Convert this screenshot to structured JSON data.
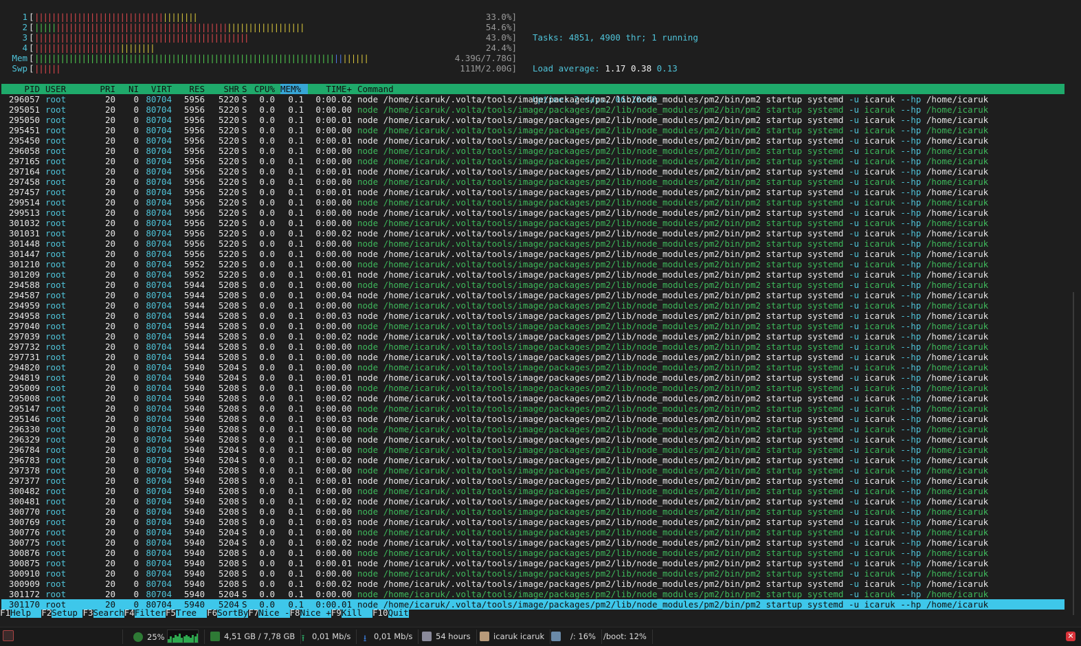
{
  "meters": [
    {
      "label": "1",
      "value": "33.0%]",
      "bars": [
        [
          "red",
          30
        ],
        [
          "yellow",
          8
        ]
      ]
    },
    {
      "label": "2",
      "value": "54.6%]",
      "bars": [
        [
          "green",
          5
        ],
        [
          "red",
          40
        ],
        [
          "yellow",
          18
        ]
      ]
    },
    {
      "label": "3",
      "value": "43.0%]",
      "bars": [
        [
          "red",
          50
        ]
      ]
    },
    {
      "label": "4",
      "value": "24.4%]",
      "bars": [
        [
          "red",
          20
        ],
        [
          "yellow",
          8
        ]
      ]
    },
    {
      "label": "Mem",
      "value": "4.39G/7.78G]",
      "bars": [
        [
          "green",
          70
        ],
        [
          "blue",
          2
        ],
        [
          "yellow",
          6
        ]
      ]
    },
    {
      "label": "Swp",
      "value": "111M/2.00G]",
      "bars": [
        [
          "red",
          6
        ]
      ]
    }
  ],
  "info": {
    "tasks_label": "Tasks: ",
    "tasks_value": "4851, ",
    "thr_value": "4900",
    "thr_label": " thr; ",
    "running_value": "1",
    "running_label": " running",
    "load_label": "Load average: ",
    "load_1": "1.17",
    "load_5": "0.38",
    "load_15": "0.13",
    "uptime_label": "Uptime: ",
    "uptime_value": "2 days, 06:10:08"
  },
  "header": {
    "pid": "PID",
    "user": "USER",
    "pri": "PRI",
    "ni": "NI",
    "virt": "VIRT",
    "res": "RES",
    "shr": "SHR",
    "s": "S",
    "cpu": "CPU%",
    "mem": "MEM%",
    "time": "TIME+",
    "command": "Command"
  },
  "common": {
    "user": "root",
    "pri": "20",
    "ni": "0",
    "virt": "80704",
    "s": "S",
    "cpu": "0.0",
    "mem": "0.1",
    "cmd_prefix": "node /home/icaruk/.volta/tools/image/packages/pm2/lib/node_modules/pm2/bin/pm2 startup systemd ",
    "flag_u": "-u",
    "cmd_user": " icaruk ",
    "flag_hp": "--hp",
    "cmd_home": " /home/icaruk"
  },
  "processes": [
    {
      "pid": "296057",
      "res": "5956",
      "shr": "5220",
      "time": "0:00.02",
      "thread": false
    },
    {
      "pid": "295051",
      "res": "5956",
      "shr": "5220",
      "time": "0:00.00",
      "thread": true
    },
    {
      "pid": "295050",
      "res": "5956",
      "shr": "5220",
      "time": "0:00.01",
      "thread": false
    },
    {
      "pid": "295451",
      "res": "5956",
      "shr": "5220",
      "time": "0:00.00",
      "thread": true
    },
    {
      "pid": "295450",
      "res": "5956",
      "shr": "5220",
      "time": "0:00.01",
      "thread": false
    },
    {
      "pid": "296058",
      "res": "5956",
      "shr": "5220",
      "time": "0:00.00",
      "thread": true
    },
    {
      "pid": "297165",
      "res": "5956",
      "shr": "5220",
      "time": "0:00.00",
      "thread": true
    },
    {
      "pid": "297164",
      "res": "5956",
      "shr": "5220",
      "time": "0:00.01",
      "thread": false
    },
    {
      "pid": "297458",
      "res": "5956",
      "shr": "5220",
      "time": "0:00.00",
      "thread": true
    },
    {
      "pid": "297457",
      "res": "5956",
      "shr": "5220",
      "time": "0:00.01",
      "thread": false
    },
    {
      "pid": "299514",
      "res": "5956",
      "shr": "5220",
      "time": "0:00.00",
      "thread": true
    },
    {
      "pid": "299513",
      "res": "5956",
      "shr": "5220",
      "time": "0:00.00",
      "thread": false
    },
    {
      "pid": "301032",
      "res": "5956",
      "shr": "5220",
      "time": "0:00.00",
      "thread": true
    },
    {
      "pid": "301031",
      "res": "5956",
      "shr": "5220",
      "time": "0:00.02",
      "thread": false
    },
    {
      "pid": "301448",
      "res": "5956",
      "shr": "5220",
      "time": "0:00.00",
      "thread": true
    },
    {
      "pid": "301447",
      "res": "5956",
      "shr": "5220",
      "time": "0:00.00",
      "thread": false
    },
    {
      "pid": "301210",
      "res": "5952",
      "shr": "5220",
      "time": "0:00.00",
      "thread": true
    },
    {
      "pid": "301209",
      "res": "5952",
      "shr": "5220",
      "time": "0:00.01",
      "thread": false
    },
    {
      "pid": "294588",
      "res": "5944",
      "shr": "5208",
      "time": "0:00.00",
      "thread": true
    },
    {
      "pid": "294587",
      "res": "5944",
      "shr": "5208",
      "time": "0:00.04",
      "thread": false
    },
    {
      "pid": "294959",
      "res": "5944",
      "shr": "5208",
      "time": "0:00.00",
      "thread": true
    },
    {
      "pid": "294958",
      "res": "5944",
      "shr": "5208",
      "time": "0:00.03",
      "thread": false
    },
    {
      "pid": "297040",
      "res": "5944",
      "shr": "5208",
      "time": "0:00.00",
      "thread": true
    },
    {
      "pid": "297039",
      "res": "5944",
      "shr": "5208",
      "time": "0:00.02",
      "thread": false
    },
    {
      "pid": "297732",
      "res": "5944",
      "shr": "5208",
      "time": "0:00.00",
      "thread": true
    },
    {
      "pid": "297731",
      "res": "5944",
      "shr": "5208",
      "time": "0:00.00",
      "thread": false
    },
    {
      "pid": "294820",
      "res": "5940",
      "shr": "5204",
      "time": "0:00.00",
      "thread": true
    },
    {
      "pid": "294819",
      "res": "5940",
      "shr": "5204",
      "time": "0:00.01",
      "thread": false
    },
    {
      "pid": "295009",
      "res": "5940",
      "shr": "5208",
      "time": "0:00.00",
      "thread": true
    },
    {
      "pid": "295008",
      "res": "5940",
      "shr": "5208",
      "time": "0:00.02",
      "thread": false
    },
    {
      "pid": "295147",
      "res": "5940",
      "shr": "5208",
      "time": "0:00.00",
      "thread": true
    },
    {
      "pid": "295146",
      "res": "5940",
      "shr": "5208",
      "time": "0:00.03",
      "thread": false
    },
    {
      "pid": "296330",
      "res": "5940",
      "shr": "5208",
      "time": "0:00.00",
      "thread": true
    },
    {
      "pid": "296329",
      "res": "5940",
      "shr": "5208",
      "time": "0:00.00",
      "thread": false
    },
    {
      "pid": "296784",
      "res": "5940",
      "shr": "5204",
      "time": "0:00.00",
      "thread": true
    },
    {
      "pid": "296783",
      "res": "5940",
      "shr": "5204",
      "time": "0:00.02",
      "thread": false
    },
    {
      "pid": "297378",
      "res": "5940",
      "shr": "5208",
      "time": "0:00.00",
      "thread": true
    },
    {
      "pid": "297377",
      "res": "5940",
      "shr": "5208",
      "time": "0:00.01",
      "thread": false
    },
    {
      "pid": "300482",
      "res": "5940",
      "shr": "5208",
      "time": "0:00.00",
      "thread": true
    },
    {
      "pid": "300481",
      "res": "5940",
      "shr": "5208",
      "time": "0:00.02",
      "thread": false
    },
    {
      "pid": "300770",
      "res": "5940",
      "shr": "5208",
      "time": "0:00.00",
      "thread": true
    },
    {
      "pid": "300769",
      "res": "5940",
      "shr": "5208",
      "time": "0:00.03",
      "thread": false
    },
    {
      "pid": "300776",
      "res": "5940",
      "shr": "5204",
      "time": "0:00.00",
      "thread": true
    },
    {
      "pid": "300775",
      "res": "5940",
      "shr": "5204",
      "time": "0:00.02",
      "thread": false
    },
    {
      "pid": "300876",
      "res": "5940",
      "shr": "5208",
      "time": "0:00.00",
      "thread": true
    },
    {
      "pid": "300875",
      "res": "5940",
      "shr": "5208",
      "time": "0:00.01",
      "thread": false
    },
    {
      "pid": "300910",
      "res": "5940",
      "shr": "5208",
      "time": "0:00.00",
      "thread": true
    },
    {
      "pid": "300909",
      "res": "5940",
      "shr": "5208",
      "time": "0:00.02",
      "thread": false
    },
    {
      "pid": "301172",
      "res": "5940",
      "shr": "5204",
      "time": "0:00.00",
      "thread": true
    },
    {
      "pid": "301170",
      "res": "5940",
      "shr": "5204",
      "time": "0:00.01",
      "thread": false,
      "selected": true
    }
  ],
  "fkeys": [
    {
      "key": "F1",
      "label": "Help  "
    },
    {
      "key": "F2",
      "label": "Setup "
    },
    {
      "key": "F3",
      "label": "Search"
    },
    {
      "key": "F4",
      "label": "Filter"
    },
    {
      "key": "F5",
      "label": "Tree  "
    },
    {
      "key": "F6",
      "label": "SortBy"
    },
    {
      "key": "F7",
      "label": "Nice -"
    },
    {
      "key": "F8",
      "label": "Nice +"
    },
    {
      "key": "F9",
      "label": "Kill  "
    },
    {
      "key": "F10",
      "label": "Quit"
    }
  ],
  "taskbar": {
    "cpu": "25%",
    "mem": "4,51 GB / 7,78 GB",
    "upload": "0,01 Mb/s",
    "download": "0,01 Mb/s",
    "uptime": "54 hours",
    "user": "icaruk  icaruk",
    "disk_root": "/: 16%",
    "disk_boot": "/boot: 12%",
    "cpu_graph": [
      0.3,
      0.5,
      0.4,
      0.6,
      0.5,
      0.7,
      0.4,
      0.5,
      0.6,
      0.5,
      0.4,
      0.6,
      0.5,
      0.7
    ]
  },
  "colors": {
    "header_bg": "#1faa6b",
    "selected_bg": "#3ec7ea",
    "accent": "#4fc3d9",
    "thread": "#3fb85c"
  }
}
